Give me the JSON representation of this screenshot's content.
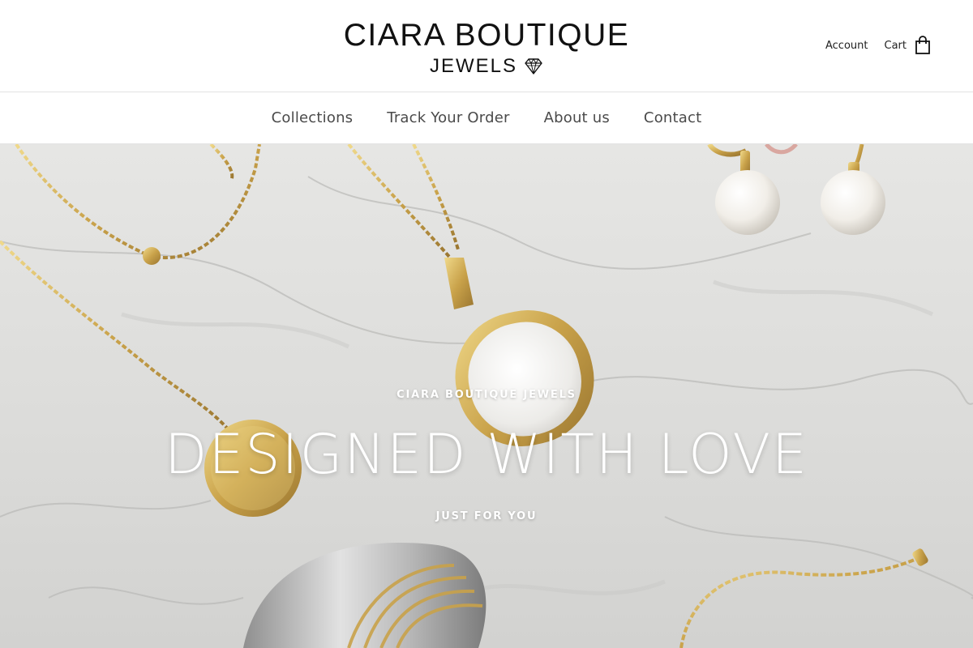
{
  "brand": {
    "name_line1": "CIARA BOUTIQUE",
    "name_line2": "JEWELS",
    "logo_icon": "diamond-icon"
  },
  "header": {
    "account_label": "Account",
    "cart_label": "Cart",
    "cart_icon": "shopping-bag-icon"
  },
  "nav": {
    "items": [
      {
        "label": "Collections"
      },
      {
        "label": "Track Your Order"
      },
      {
        "label": "About us"
      },
      {
        "label": "Contact"
      }
    ]
  },
  "hero": {
    "eyebrow": "CIARA BOUTIQUE JEWELS",
    "title": "DESIGNED WITH LOVE",
    "subtitle": "JUST FOR YOU",
    "text_color": "#ffffff"
  },
  "colors": {
    "background": "#ffffff",
    "text": "#222222",
    "nav_text": "#4a4a4a",
    "gold": "#c9a24a",
    "marble": "#dcdcda"
  }
}
